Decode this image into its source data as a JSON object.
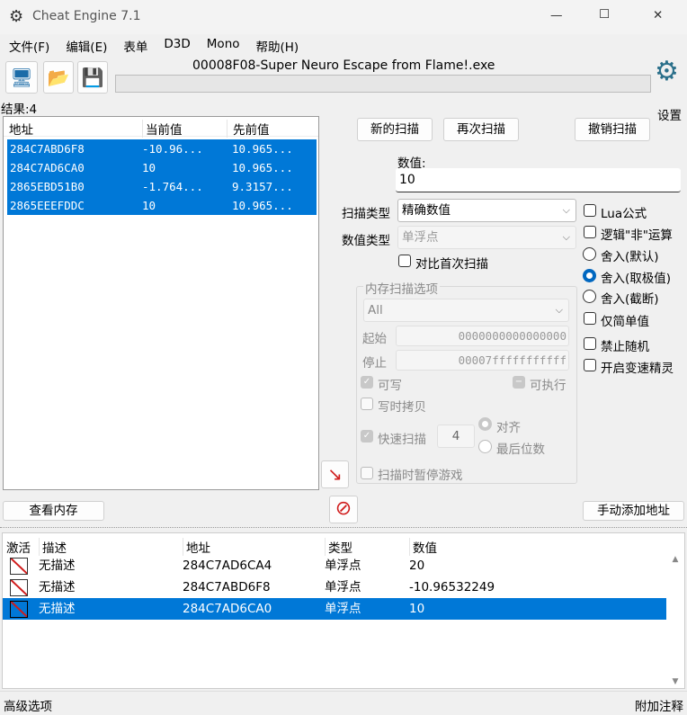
{
  "window": {
    "title": "Cheat Engine 7.1",
    "min": "—",
    "max": "☐",
    "close": "✕"
  },
  "menu": [
    "文件(F)",
    "编辑(E)",
    "表单",
    "D3D",
    "Mono",
    "帮助(H)"
  ],
  "process_title": "00008F08-Super Neuro Escape from Flame!.exe",
  "settings_label": "设置",
  "results_label": "结果:4",
  "scan_list": {
    "headers": [
      "地址",
      "当前值",
      "先前值"
    ],
    "rows": [
      [
        "284C7ABD6F8",
        "-10.96...",
        "10.965..."
      ],
      [
        "284C7AD6CA0",
        "10",
        "10.965..."
      ],
      [
        "2865EBD51B0",
        "-1.764...",
        "9.3157..."
      ],
      [
        "2865EEEFDDC",
        "10",
        "10.965..."
      ]
    ]
  },
  "buttons": {
    "new_scan": "新的扫描",
    "next_scan": "再次扫描",
    "undo_scan": "撤销扫描",
    "view_memory": "查看内存",
    "add_address": "手动添加地址"
  },
  "value": {
    "label": "数值:",
    "value": "10"
  },
  "scan_type": {
    "label": "扫描类型",
    "value": "精确数值"
  },
  "value_type": {
    "label": "数值类型",
    "value": "单浮点"
  },
  "compare_first": "对比首次扫描",
  "options": {
    "lua": "Lua公式",
    "not": "逻辑\"非\"运算",
    "round_default": "舍入(默认)",
    "round_extreme": "舍入(取极值)",
    "round_trunc": "舍入(截断)",
    "simple": "仅简单值",
    "no_random": "禁止随机",
    "speedhack": "开启变速精灵"
  },
  "mem": {
    "title": "内存扫描选项",
    "region": "All",
    "start_label": "起始",
    "start": "0000000000000000",
    "stop_label": "停止",
    "stop": "00007fffffffffff",
    "writable": "可写",
    "executable": "可执行",
    "cow": "写时拷贝",
    "fast_scan": "快速扫描",
    "fast_value": "4",
    "align": "对齐",
    "last_digits": "最后位数",
    "pause": "扫描时暂停游戏"
  },
  "cheat_table": {
    "headers": [
      "激活",
      "描述",
      "地址",
      "类型",
      "数值"
    ],
    "rows": [
      {
        "desc": "无描述",
        "addr": "284C7AD6CA4",
        "type": "单浮点",
        "value": "20"
      },
      {
        "desc": "无描述",
        "addr": "284C7ABD6F8",
        "type": "单浮点",
        "value": "-10.96532249"
      },
      {
        "desc": "无描述",
        "addr": "284C7AD6CA0",
        "type": "单浮点",
        "value": "10"
      }
    ]
  },
  "status": {
    "left": "高级选项",
    "right": "附加注释"
  }
}
